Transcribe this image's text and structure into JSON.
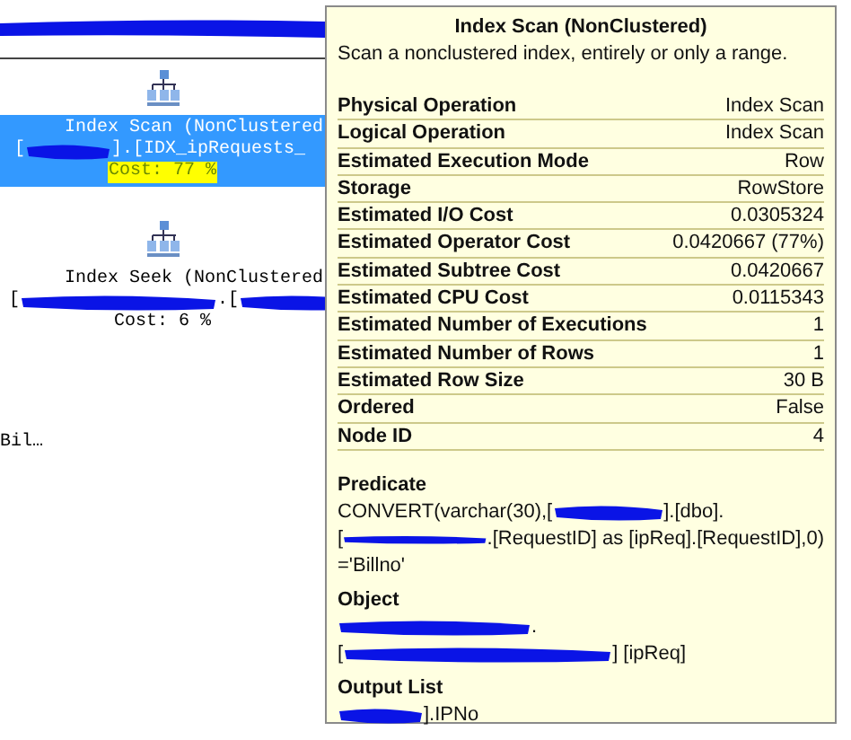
{
  "plan": {
    "nodes": [
      {
        "selected": true,
        "name": "Index Scan (NonClustered",
        "object": [
          {
            "kind": "text",
            "text": "["
          },
          {
            "kind": "redacted"
          },
          {
            "kind": "text",
            "text": "].[IDX_ipRequests_"
          }
        ],
        "cost": "Cost: 77 %",
        "highlighted": true
      },
      {
        "selected": false,
        "name": "Index Seek (NonClustered",
        "object": [
          {
            "kind": "text",
            "text": "["
          },
          {
            "kind": "redacted"
          },
          {
            "kind": "text",
            "text": ".["
          },
          {
            "kind": "redacted"
          }
        ],
        "cost": "Cost: 6 %",
        "highlighted": false
      }
    ],
    "truncated_label": "Bil…"
  },
  "tooltip": {
    "title": "Index Scan (NonClustered)",
    "description": "Scan a nonclustered index, entirely or only a range.",
    "properties": [
      {
        "name": "Physical Operation",
        "value": "Index Scan"
      },
      {
        "name": "Logical Operation",
        "value": "Index Scan"
      },
      {
        "name": "Estimated Execution Mode",
        "value": "Row"
      },
      {
        "name": "Storage",
        "value": "RowStore"
      },
      {
        "name": "Estimated I/O Cost",
        "value": "0.0305324"
      },
      {
        "name": "Estimated Operator Cost",
        "value": "0.0420667 (77%)"
      },
      {
        "name": "Estimated Subtree Cost",
        "value": "0.0420667"
      },
      {
        "name": "Estimated CPU Cost",
        "value": "0.0115343"
      },
      {
        "name": "Estimated Number of Executions",
        "value": "1"
      },
      {
        "name": "Estimated Number of Rows",
        "value": "1"
      },
      {
        "name": "Estimated Row Size",
        "value": "30 B"
      },
      {
        "name": "Ordered",
        "value": "False"
      },
      {
        "name": "Node ID",
        "value": "4"
      }
    ],
    "sections": [
      {
        "heading": "Predicate",
        "lines": [
          [
            {
              "kind": "text",
              "text": "CONVERT(varchar(30),["
            },
            {
              "kind": "redacted"
            },
            {
              "kind": "text",
              "text": "].[dbo]."
            }
          ],
          [
            {
              "kind": "text",
              "text": "["
            },
            {
              "kind": "redacted"
            },
            {
              "kind": "text",
              "text": ".[RequestID] as [ipReq].[RequestID],0)"
            }
          ],
          [
            {
              "kind": "text",
              "text": "='Billno'"
            }
          ]
        ]
      },
      {
        "heading": "Object",
        "lines": [
          [
            {
              "kind": "redacted"
            },
            {
              "kind": "text",
              "text": "."
            }
          ],
          [
            {
              "kind": "text",
              "text": "["
            },
            {
              "kind": "redacted"
            },
            {
              "kind": "text",
              "text": "] [ipReq]"
            }
          ]
        ]
      },
      {
        "heading": "Output List",
        "lines": [
          [
            {
              "kind": "redacted"
            },
            {
              "kind": "text",
              "text": "].IPNo"
            }
          ]
        ]
      }
    ]
  }
}
